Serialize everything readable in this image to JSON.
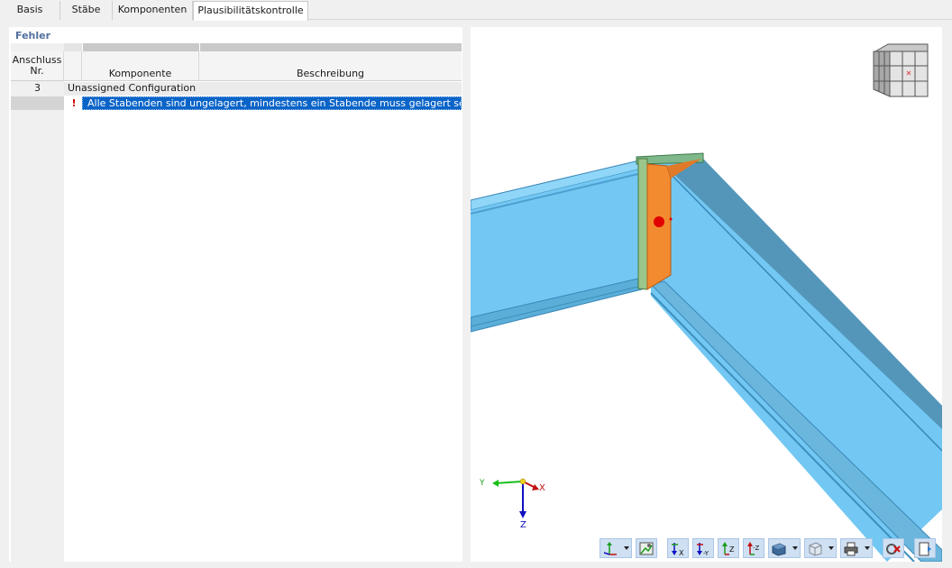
{
  "tabs": [
    {
      "label": "Basis"
    },
    {
      "label": "Stäbe"
    },
    {
      "label": "Komponenten"
    },
    {
      "label": "Plausibilitätskontrolle"
    }
  ],
  "errors_section": {
    "title": "Fehler",
    "columns": {
      "anschluss": "Anschluss Nr.",
      "komponente": "Komponente",
      "beschreibung": "Beschreibung"
    },
    "group": {
      "number": "3",
      "label": "Unassigned Configuration"
    },
    "rows": [
      {
        "icon": "error-exclamation-icon",
        "message": "Alle Stabenden sind ungelagert, mindestens ein Stabende muss gelagert sein"
      }
    ]
  },
  "view": {
    "axes": {
      "x": "X",
      "y": "Y",
      "z": "Z"
    },
    "colors": {
      "beam": "#6ec8f5",
      "plate": "#f28a30",
      "selection": "#0a64c8",
      "error_dot": "#e00000"
    }
  },
  "toolbar": {
    "buttons": [
      {
        "name": "axis-view-dropdown-button",
        "icon": "axes-icon",
        "dropdown": true
      },
      {
        "name": "render-settings-button",
        "icon": "render-settings-icon",
        "dropdown": false
      },
      {
        "name": "view-x-button",
        "icon": "view-x-icon",
        "dropdown": false
      },
      {
        "name": "view-minus-y-button",
        "icon": "view-minus-y-icon",
        "dropdown": false
      },
      {
        "name": "view-z-button",
        "icon": "view-z-icon",
        "dropdown": false
      },
      {
        "name": "view-minus-z-button",
        "icon": "view-minus-z-icon",
        "dropdown": false
      },
      {
        "name": "display-mode-dropdown-button",
        "icon": "solid-display-icon",
        "dropdown": true
      },
      {
        "name": "wireframe-dropdown-button",
        "icon": "wireframe-box-icon",
        "dropdown": true
      },
      {
        "name": "print-dropdown-button",
        "icon": "printer-icon",
        "dropdown": true
      },
      {
        "name": "reset-view-button",
        "icon": "reset-view-icon",
        "dropdown": false
      },
      {
        "name": "exit-view-button",
        "icon": "exit-view-icon",
        "dropdown": false
      }
    ]
  }
}
